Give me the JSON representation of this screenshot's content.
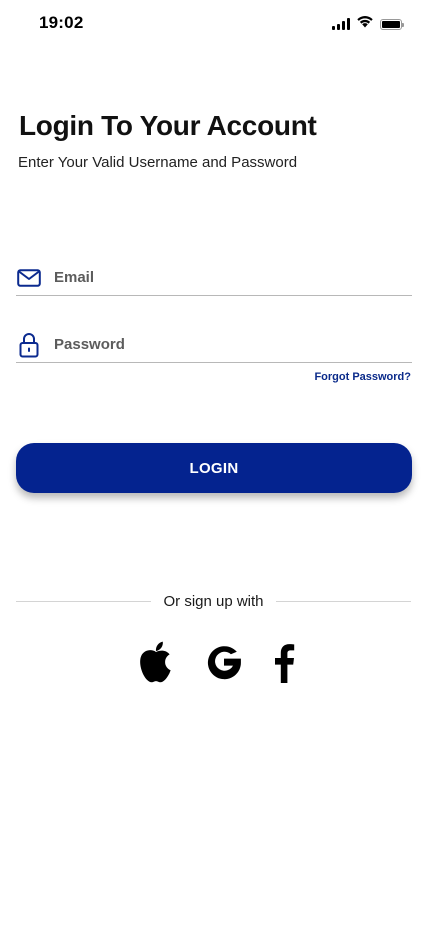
{
  "status_bar": {
    "time": "19:02",
    "signal_icon": "cellular-signal-icon",
    "wifi_icon": "wifi-icon",
    "battery_icon": "battery-icon"
  },
  "header": {
    "title": "Login To Your Account",
    "subtitle": "Enter Your Valid Username and Password"
  },
  "form": {
    "email": {
      "placeholder": "Email",
      "value": "",
      "icon": "mail-icon"
    },
    "password": {
      "placeholder": "Password",
      "value": "",
      "icon": "lock-icon"
    },
    "forgot_password_label": "Forgot Password?",
    "login_label": "LOGIN"
  },
  "social": {
    "divider_text": "Or sign up with",
    "providers": [
      {
        "name": "apple",
        "icon": "apple-icon"
      },
      {
        "name": "google",
        "icon": "google-icon"
      },
      {
        "name": "facebook",
        "icon": "facebook-icon"
      }
    ]
  },
  "colors": {
    "primary": "#04238f",
    "link": "#0a2a8a",
    "icon_blue": "#0b2a8f",
    "text": "#111111"
  }
}
